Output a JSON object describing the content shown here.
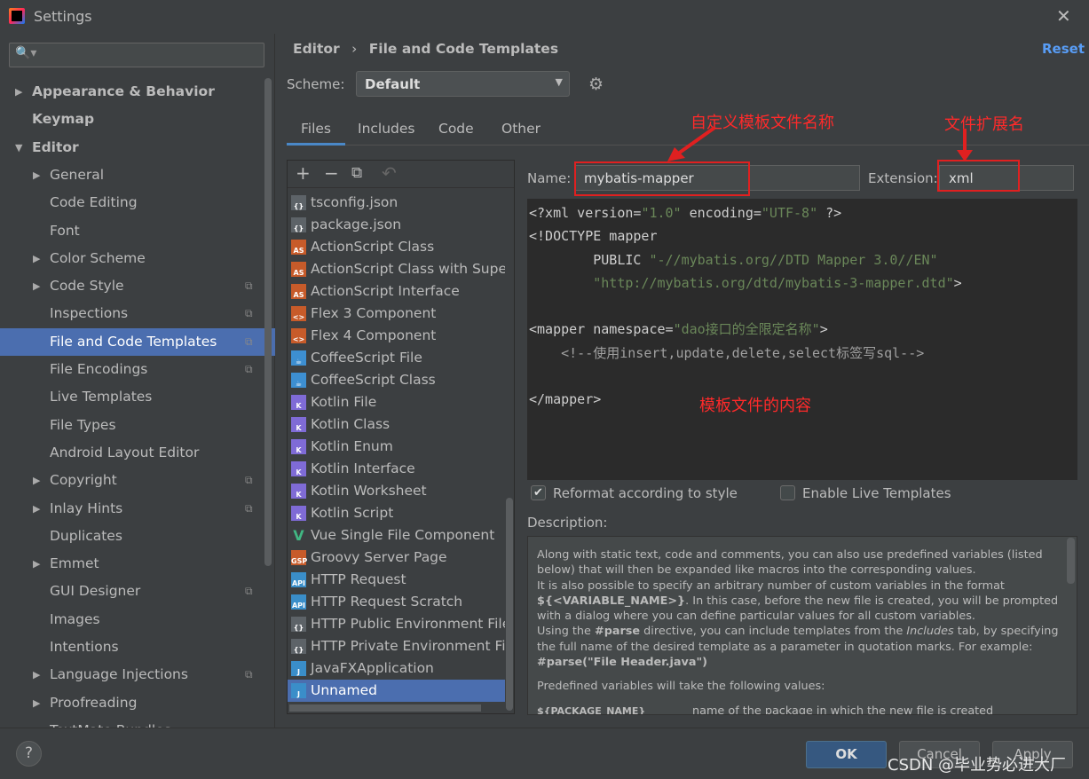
{
  "window": {
    "title": "Settings",
    "close": "✕"
  },
  "sidebar": {
    "search_placeholder": "🔍▾",
    "items": [
      {
        "label": "Appearance & Behavior",
        "arrow": "▶",
        "bold": true,
        "level": 0
      },
      {
        "label": "Keymap",
        "arrow": "",
        "bold": true,
        "level": 0
      },
      {
        "label": "Editor",
        "arrow": "▼",
        "bold": true,
        "level": 0
      },
      {
        "label": "General",
        "arrow": "▶",
        "level": 1
      },
      {
        "label": "Code Editing",
        "arrow": "",
        "level": 1
      },
      {
        "label": "Font",
        "arrow": "",
        "level": 1
      },
      {
        "label": "Color Scheme",
        "arrow": "▶",
        "level": 1
      },
      {
        "label": "Code Style",
        "arrow": "▶",
        "level": 1,
        "copy": true
      },
      {
        "label": "Inspections",
        "arrow": "",
        "level": 1,
        "copy": true
      },
      {
        "label": "File and Code Templates",
        "arrow": "",
        "level": 1,
        "copy": true,
        "selected": true
      },
      {
        "label": "File Encodings",
        "arrow": "",
        "level": 1,
        "copy": true
      },
      {
        "label": "Live Templates",
        "arrow": "",
        "level": 1
      },
      {
        "label": "File Types",
        "arrow": "",
        "level": 1
      },
      {
        "label": "Android Layout Editor",
        "arrow": "",
        "level": 1
      },
      {
        "label": "Copyright",
        "arrow": "▶",
        "level": 1,
        "copy": true
      },
      {
        "label": "Inlay Hints",
        "arrow": "▶",
        "level": 1,
        "copy": true
      },
      {
        "label": "Duplicates",
        "arrow": "",
        "level": 1
      },
      {
        "label": "Emmet",
        "arrow": "▶",
        "level": 1
      },
      {
        "label": "GUI Designer",
        "arrow": "",
        "level": 1,
        "copy": true
      },
      {
        "label": "Images",
        "arrow": "",
        "level": 1
      },
      {
        "label": "Intentions",
        "arrow": "",
        "level": 1
      },
      {
        "label": "Language Injections",
        "arrow": "▶",
        "level": 1,
        "copy": true
      },
      {
        "label": "Proofreading",
        "arrow": "▶",
        "level": 1
      },
      {
        "label": "TextMate Bundles",
        "arrow": "",
        "level": 1
      }
    ]
  },
  "header": {
    "breadcrumb_parent": "Editor",
    "breadcrumb_sep": "›",
    "breadcrumb_current": "File and Code Templates",
    "reset": "Reset"
  },
  "scheme": {
    "label": "Scheme:",
    "value": "Default"
  },
  "tabs": [
    "Files",
    "Includes",
    "Code",
    "Other"
  ],
  "files": {
    "toolbar": [
      "+",
      "−",
      "⧉",
      "↶"
    ],
    "items": [
      {
        "label": "tsconfig.json",
        "icon": "json",
        "badge": "{}"
      },
      {
        "label": "package.json",
        "icon": "json",
        "badge": "{}"
      },
      {
        "label": "ActionScript Class",
        "icon": "as",
        "badge": "AS"
      },
      {
        "label": "ActionScript Class with Supers",
        "icon": "as",
        "badge": "AS"
      },
      {
        "label": "ActionScript Interface",
        "icon": "as",
        "badge": "AS"
      },
      {
        "label": "Flex 3 Component",
        "icon": "flex",
        "badge": "<>"
      },
      {
        "label": "Flex 4 Component",
        "icon": "flex",
        "badge": "<>"
      },
      {
        "label": "CoffeeScript File",
        "icon": "coffee",
        "badge": "☕"
      },
      {
        "label": "CoffeeScript Class",
        "icon": "coffee",
        "badge": "☕"
      },
      {
        "label": "Kotlin File",
        "icon": "kotlin",
        "badge": "K"
      },
      {
        "label": "Kotlin Class",
        "icon": "kotlin",
        "badge": "K"
      },
      {
        "label": "Kotlin Enum",
        "icon": "kotlin",
        "badge": "K"
      },
      {
        "label": "Kotlin Interface",
        "icon": "kotlin",
        "badge": "K"
      },
      {
        "label": "Kotlin Worksheet",
        "icon": "kotlin",
        "badge": "K"
      },
      {
        "label": "Kotlin Script",
        "icon": "kotlin",
        "badge": "K"
      },
      {
        "label": "Vue Single File Component",
        "icon": "vue",
        "badge": "V"
      },
      {
        "label": "Groovy Server Page",
        "icon": "gsp",
        "badge": "GSP"
      },
      {
        "label": "HTTP Request",
        "icon": "api",
        "badge": "API"
      },
      {
        "label": "HTTP Request Scratch",
        "icon": "api",
        "badge": "API"
      },
      {
        "label": "HTTP Public Environment File",
        "icon": "json",
        "badge": "{}"
      },
      {
        "label": "HTTP Private Environment File",
        "icon": "json",
        "badge": "{}"
      },
      {
        "label": "JavaFXApplication",
        "icon": "java",
        "badge": "J"
      },
      {
        "label": "Unnamed",
        "icon": "java",
        "badge": "J",
        "selected": true
      }
    ]
  },
  "template": {
    "name_label": "Name:",
    "name_value": "mybatis-mapper",
    "ext_label": "Extension:",
    "ext_value": "xml",
    "code": [
      [
        [
          "<?xml version=",
          ""
        ],
        [
          "\"1.0\"",
          "s"
        ],
        [
          " encoding=",
          ""
        ],
        [
          "\"UTF-8\"",
          "s"
        ],
        [
          " ?>",
          ""
        ]
      ],
      [
        [
          "<!DOCTYPE mapper",
          ""
        ]
      ],
      [
        [
          "        PUBLIC ",
          ""
        ],
        [
          "\"-//mybatis.org//DTD Mapper 3.0//EN\"",
          "s"
        ]
      ],
      [
        [
          "        ",
          ""
        ],
        [
          "\"http://mybatis.org/dtd/mybatis-3-mapper.dtd\"",
          "s"
        ],
        [
          ">",
          ""
        ]
      ],
      [
        [
          "",
          ""
        ]
      ],
      [
        [
          "<mapper namespace=",
          ""
        ],
        [
          "\"dao接口的全限定名称\"",
          "s"
        ],
        [
          ">",
          ""
        ]
      ],
      [
        [
          "    <!--使用insert,update,delete,select标签写sql-->",
          "cm"
        ]
      ],
      [
        [
          "",
          ""
        ]
      ],
      [
        [
          "</mapper>",
          ""
        ]
      ]
    ],
    "reformat_label": "Reformat according to style",
    "reformat_checked": true,
    "live_label": "Enable Live Templates",
    "live_checked": false,
    "description_label": "Description:"
  },
  "annotations": {
    "name": "自定义模板文件名称",
    "ext": "文件扩展名",
    "content": "模板文件的内容",
    "color": "#ff2a2a"
  },
  "description": {
    "p1a": "Along with static text, code and comments, you can also use predefined variables (listed below) that will then be expanded like macros into the corresponding values.",
    "p1b": "It is also possible to specify an arbitrary number of custom variables in the format ",
    "var": "${<VARIABLE_NAME>}",
    "p1c": ". In this case, before the new file is created, you will be prompted with a dialog where you can define particular values for all custom variables.",
    "p2a": "Using the ",
    "parse": "#parse",
    "p2b": " directive, you can include templates from the ",
    "includes": "Includes",
    "p2c": " tab, by specifying the full name of the desired template as a parameter in quotation marks. For example:",
    "example": "#parse(\"File Header.java\")",
    "p3": "Predefined variables will take the following values:",
    "row_var": "${PACKAGE_NAME}",
    "row_desc": "name of the package in which the new file is created"
  },
  "footer": {
    "help": "?",
    "ok": "OK",
    "cancel": "Cancel",
    "apply": "Apply",
    "watermark": "CSDN @毕业势必进大厂"
  },
  "colors": {
    "accent": "#4b6eaf",
    "link": "#589df6",
    "ok": "#365880",
    "editor_bg": "#2b2b2b",
    "string": "#6a8759"
  }
}
